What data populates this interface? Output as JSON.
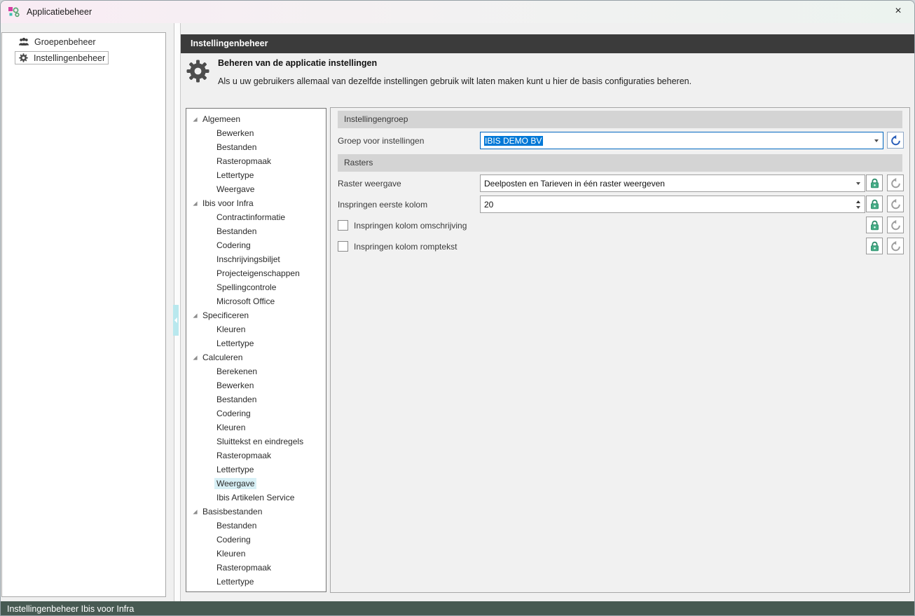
{
  "window": {
    "title": "Applicatiebeheer",
    "close_glyph": "×"
  },
  "sidebar": {
    "items": [
      {
        "label": "Groepenbeheer"
      },
      {
        "label": "Instellingenbeheer",
        "selected": true
      }
    ]
  },
  "main": {
    "header_title": "Instellingenbeheer",
    "intro_heading": "Beheren van de applicatie instellingen",
    "intro_description": "Als u uw gebruikers allemaal van dezelfde instellingen gebruik wilt laten maken kunt u hier de basis configuraties beheren."
  },
  "tree": {
    "groups": [
      {
        "label": "Algemeen",
        "children": [
          "Bewerken",
          "Bestanden",
          "Rasteropmaak",
          "Lettertype",
          "Weergave"
        ]
      },
      {
        "label": "Ibis voor Infra",
        "children": [
          "Contractinformatie",
          "Bestanden",
          "Codering",
          "Inschrijvingsbiljet",
          "Projecteigenschappen",
          "Spellingcontrole",
          "Microsoft Office"
        ]
      },
      {
        "label": "Specificeren",
        "children": [
          "Kleuren",
          "Lettertype"
        ]
      },
      {
        "label": "Calculeren",
        "children": [
          "Berekenen",
          "Bewerken",
          "Bestanden",
          "Codering",
          "Kleuren",
          "Sluittekst en eindregels",
          "Rasteropmaak",
          "Lettertype",
          "Weergave",
          "Ibis Artikelen Service"
        ]
      },
      {
        "label": "Basisbestanden",
        "children": [
          "Bestanden",
          "Codering",
          "Kleuren",
          "Rasteropmaak",
          "Lettertype"
        ]
      }
    ],
    "selected": {
      "group": 3,
      "child": 8
    }
  },
  "settings": {
    "sections": [
      {
        "title": "Instellingengroep"
      },
      {
        "title": "Rasters"
      }
    ],
    "rows": {
      "groep": {
        "label": "Groep voor instellingen",
        "value": "IBIS DEMO BV",
        "text_selected": true,
        "undo": "active"
      },
      "raster_weergave": {
        "label": "Raster weergave",
        "value": "Deelposten en Tarieven in één raster weergeven",
        "locked": true,
        "undo": "disabled"
      },
      "inspringen_eerste_kolom": {
        "label": "Inspringen eerste kolom",
        "value": "20",
        "locked": true,
        "undo": "disabled"
      },
      "omschrijving": {
        "label": "Inspringen kolom omschrijving",
        "checked": false,
        "locked": true,
        "undo": "disabled"
      },
      "romptekst": {
        "label": "Inspringen kolom romptekst",
        "checked": false,
        "locked": true,
        "undo": "disabled"
      }
    }
  },
  "statusbar": {
    "text": "Instellingenbeheer Ibis voor Infra"
  },
  "colors": {
    "selection_blue": "#0078d7",
    "lock_green": "#44ab85",
    "undo_blue": "#2a5fba",
    "undo_disabled": "#9f9f9f",
    "header_dark": "#3b3b3b",
    "status_bg": "#475a52",
    "tree_selection": "#d8f0f6",
    "titlebar_gradient_left": "#f9ecf4",
    "titlebar_gradient_right": "#ecf3ef"
  }
}
